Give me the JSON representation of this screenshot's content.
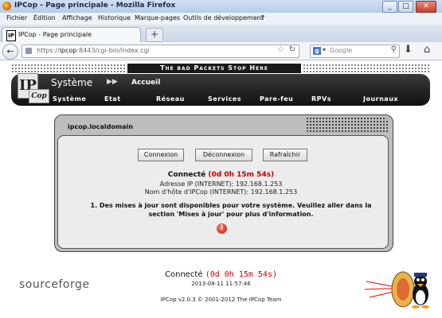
{
  "window": {
    "title": "IPCop - Page principale - Mozilla Firefox",
    "min": "_",
    "max": "□",
    "close": "✕"
  },
  "menubar": [
    "Fichier",
    "Édition",
    "Affichage",
    "Historique",
    "Marque-pages",
    "Outils de développement",
    "?"
  ],
  "tab": {
    "favicon": "IP",
    "label": "IPCop - Page principale",
    "new_tab": "+"
  },
  "nav": {
    "back": "←",
    "url_prefix": "https://",
    "url_host": "ipcop",
    "url_rest": ":8443/cgi-bin/index.cgi",
    "star": "☆",
    "reload": "↻",
    "search_engine": "g",
    "search_dropdown": "▾",
    "search_placeholder": "Google",
    "search_icon": "⚲",
    "download": "⬇",
    "home": "⌂"
  },
  "page": {
    "banner": "The bad Packets Stop Here",
    "logo_ip": "IP",
    "logo_cop": "Cop",
    "section": "Système",
    "arrows": "▶▶",
    "breadcrumb": "Accueil",
    "menu": [
      "Système",
      "Etat",
      "Réseau",
      "Services",
      "Pare-feu",
      "RPVs",
      "Journaux"
    ],
    "panel_title": "ipcop.localdomain",
    "buttons": {
      "connect": "Connexion",
      "disconnect": "Déconnexion",
      "refresh": "Rafraîchir"
    },
    "status_label": "Connecté",
    "status_time": "(0d 0h 15m 54s)",
    "ip_line": "Adresse IP (INTERNET): 192.168.1.253",
    "host_line": "Nom d'hôte d'IPCop (INTERNET): 192.168.1.253",
    "update_notice": "1.  Des mises à jour sont disponibles pour votre système. Veuillez aller dans la section 'Mises à jour' pour plus d'information.",
    "info_glyph": "i"
  },
  "footer": {
    "sourceforge": "sourceforge",
    "status_label": "Connecté",
    "status_time": "(0d 0h 15m 54s)",
    "datetime": "2013-08-11 11:57:46",
    "copyright": "IPCop v2.0.3 © 2001-2012 The IPCop Team"
  }
}
